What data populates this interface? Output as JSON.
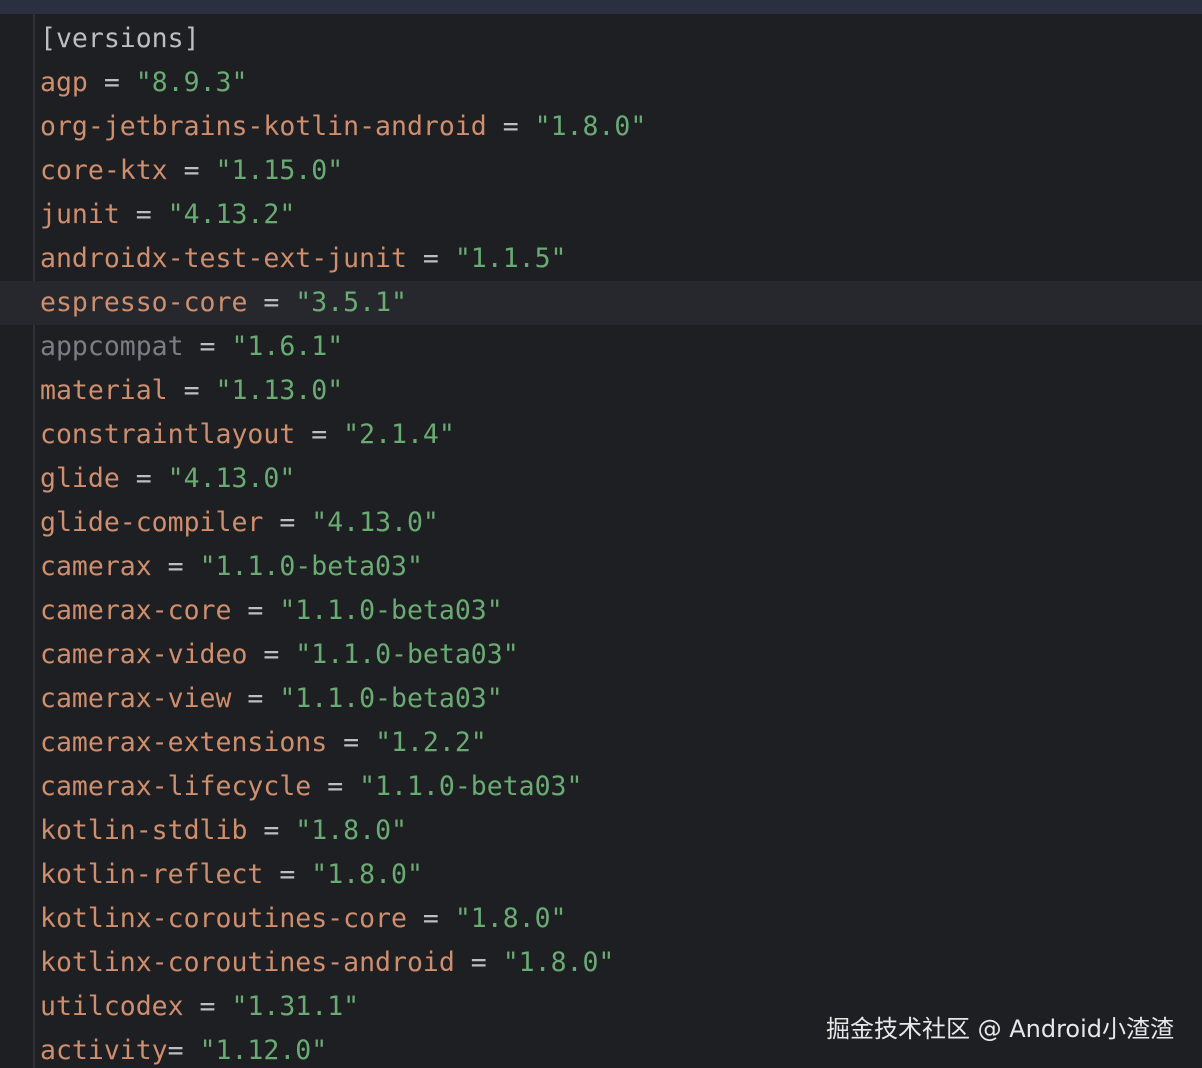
{
  "colors": {
    "background": "#1e1f22",
    "current_line": "#26282e",
    "key": "#cf8e6d",
    "unused_key": "#7a7e85",
    "string": "#6aab73",
    "text": "#bcbec4"
  },
  "editor": {
    "lines": [
      {
        "header": "[versions]"
      },
      {
        "key": "agp",
        "op": " = ",
        "value": "\"8.9.3\""
      },
      {
        "key": "org-jetbrains-kotlin-android",
        "op": " = ",
        "value": "\"1.8.0\""
      },
      {
        "key": "core-ktx",
        "op": " = ",
        "value": "\"1.15.0\""
      },
      {
        "key": "junit",
        "op": " = ",
        "value": "\"4.13.2\""
      },
      {
        "key": "androidx-test-ext-junit",
        "op": " = ",
        "value": "\"1.1.5\""
      },
      {
        "key": "espresso-core",
        "op": " = ",
        "value": "\"3.5.1\"",
        "current": true
      },
      {
        "key": "appcompat",
        "op": " = ",
        "value": "\"1.6.1\"",
        "unused": true
      },
      {
        "key": "material",
        "op": " = ",
        "value": "\"1.13.0\""
      },
      {
        "key": "constraintlayout",
        "op": " = ",
        "value": "\"2.1.4\""
      },
      {
        "key": "glide",
        "op": " = ",
        "value": "\"4.13.0\""
      },
      {
        "key": "glide-compiler",
        "op": " = ",
        "value": "\"4.13.0\""
      },
      {
        "key": "camerax",
        "op": " = ",
        "value": "\"1.1.0-beta03\""
      },
      {
        "key": "camerax-core",
        "op": " = ",
        "value": "\"1.1.0-beta03\""
      },
      {
        "key": "camerax-video",
        "op": " = ",
        "value": "\"1.1.0-beta03\""
      },
      {
        "key": "camerax-view",
        "op": " = ",
        "value": "\"1.1.0-beta03\""
      },
      {
        "key": "camerax-extensions",
        "op": " = ",
        "value": "\"1.2.2\""
      },
      {
        "key": "camerax-lifecycle",
        "op": " = ",
        "value": "\"1.1.0-beta03\""
      },
      {
        "key": "kotlin-stdlib",
        "op": " = ",
        "value": "\"1.8.0\""
      },
      {
        "key": "kotlin-reflect",
        "op": " = ",
        "value": "\"1.8.0\""
      },
      {
        "key": "kotlinx-coroutines-core",
        "op": " = ",
        "value": "\"1.8.0\""
      },
      {
        "key": "kotlinx-coroutines-android",
        "op": " = ",
        "value": "\"1.8.0\""
      },
      {
        "key": "utilcodex",
        "op": " = ",
        "value": "\"1.31.1\""
      },
      {
        "key": "activity",
        "op": "= ",
        "value": "\"1.12.0\""
      }
    ]
  },
  "watermark": "掘金技术社区 @ Android小渣渣"
}
